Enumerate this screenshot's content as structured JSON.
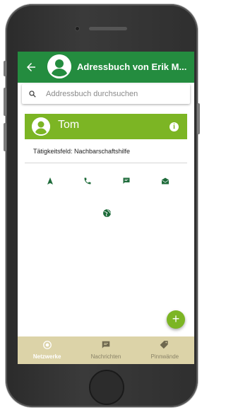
{
  "colors": {
    "header_green": "#248c3f",
    "accent_green": "#7cb524",
    "nav_bg": "#dcd3a8",
    "icon_green": "#1e6b3a"
  },
  "header": {
    "title": "Adressbuch von Erik M...",
    "back_icon": "arrow-left-icon",
    "avatar_icon": "person-avatar-icon"
  },
  "search": {
    "placeholder": "Addressbuch durchsuchen",
    "value": "",
    "icon": "search-icon"
  },
  "contact": {
    "name": "Tom",
    "field_line": "Tätigkeitsfeld: Nachbarschaftshilfe",
    "info_icon_glyph": "i"
  },
  "actions": [
    {
      "name": "navigate-icon"
    },
    {
      "name": "phone-icon"
    },
    {
      "name": "chat-icon"
    },
    {
      "name": "mail-icon"
    },
    {
      "name": "globe-icon"
    }
  ],
  "fab": {
    "glyph": "+",
    "icon": "add-icon"
  },
  "bottom_nav": [
    {
      "label": "Netzwerke",
      "icon": "network-icon",
      "active": true
    },
    {
      "label": "Nachrichten",
      "icon": "chat-icon",
      "active": false
    },
    {
      "label": "Pinnwände",
      "icon": "tag-icon",
      "active": false
    }
  ]
}
